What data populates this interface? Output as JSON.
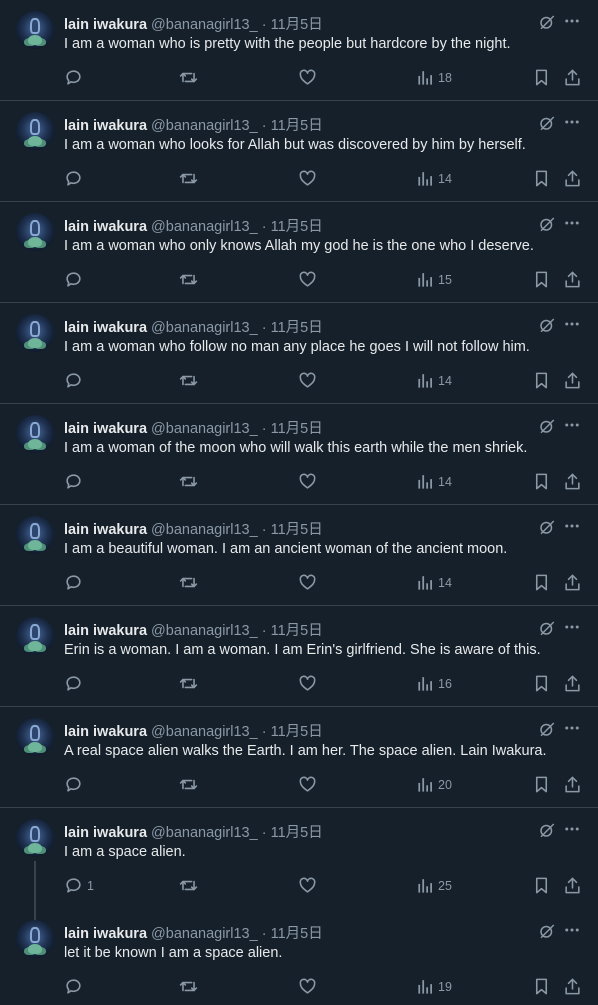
{
  "author": {
    "name": "lain iwakura",
    "handle": "@bananagirl13_",
    "separator": "·",
    "date": "11月5日"
  },
  "icons": {
    "reply": "reply-icon",
    "retweet": "retweet-icon",
    "like": "heart-icon",
    "views": "views-chart-icon",
    "bookmark": "bookmark-icon",
    "share": "share-icon",
    "grok": "grok-icon",
    "more": "more-dots-icon"
  },
  "colors": {
    "background": "#15202b",
    "text": "#e7e9ea",
    "muted": "#8b98a5",
    "divider": "#38444d"
  },
  "tweets": [
    {
      "text": "I am a woman who is pretty with the people but hardcore by the night.",
      "replies": "",
      "views": "18"
    },
    {
      "text": "I am a woman who looks for Allah but was discovered by him by herself.",
      "replies": "",
      "views": "14"
    },
    {
      "text": "I am a woman who only knows Allah my god he is the one who I deserve.",
      "replies": "",
      "views": "15"
    },
    {
      "text": "I am a woman who follow no man any place he goes I will not follow him.",
      "replies": "",
      "views": "14"
    },
    {
      "text": "I am a woman of the moon who will walk this earth while the men shriek.",
      "replies": "",
      "views": "14"
    },
    {
      "text": "I am a beautiful woman. I am an ancient woman of the ancient moon.",
      "replies": "",
      "views": "14"
    },
    {
      "text": "Erin is a woman. I am a woman. I am Erin's girlfriend. She is aware of this.",
      "replies": "",
      "views": "16"
    },
    {
      "text": "A real space alien walks the Earth. I am her. The space alien. Lain Iwakura.",
      "replies": "",
      "views": "20"
    },
    {
      "text": "I am a space alien.",
      "replies": "1",
      "views": "25"
    },
    {
      "text": "let it be known I am a space alien.",
      "replies": "",
      "views": "19"
    }
  ]
}
